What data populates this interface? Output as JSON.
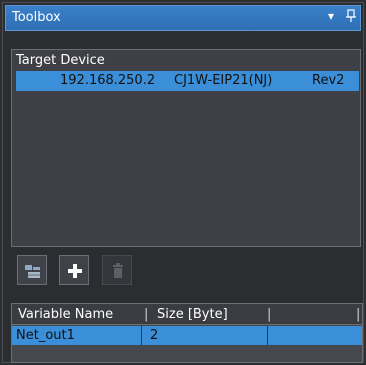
{
  "panel": {
    "title": "Toolbox",
    "dropdown_glyph": "▾",
    "pin_glyph": "ᵾ"
  },
  "device_list": {
    "header": "Target Device",
    "rows": [
      {
        "ip": "192.168.250.2",
        "model": "CJ1W-EIP21(NJ)",
        "revision": "Rev2"
      }
    ]
  },
  "toolbar": {
    "buttons": [
      {
        "icon": "device-tree-icon",
        "enabled": true
      },
      {
        "icon": "plus-icon",
        "enabled": true
      },
      {
        "icon": "trash-icon",
        "enabled": false
      }
    ]
  },
  "variables": {
    "columns": [
      "Variable Name",
      "Size [Byte]"
    ],
    "rows": [
      {
        "name": "Net_out1",
        "size": "2"
      }
    ]
  },
  "colors": {
    "title_bar": "#2f6fb4",
    "selection": "#3b8fd8",
    "background": "#2d2f33"
  }
}
